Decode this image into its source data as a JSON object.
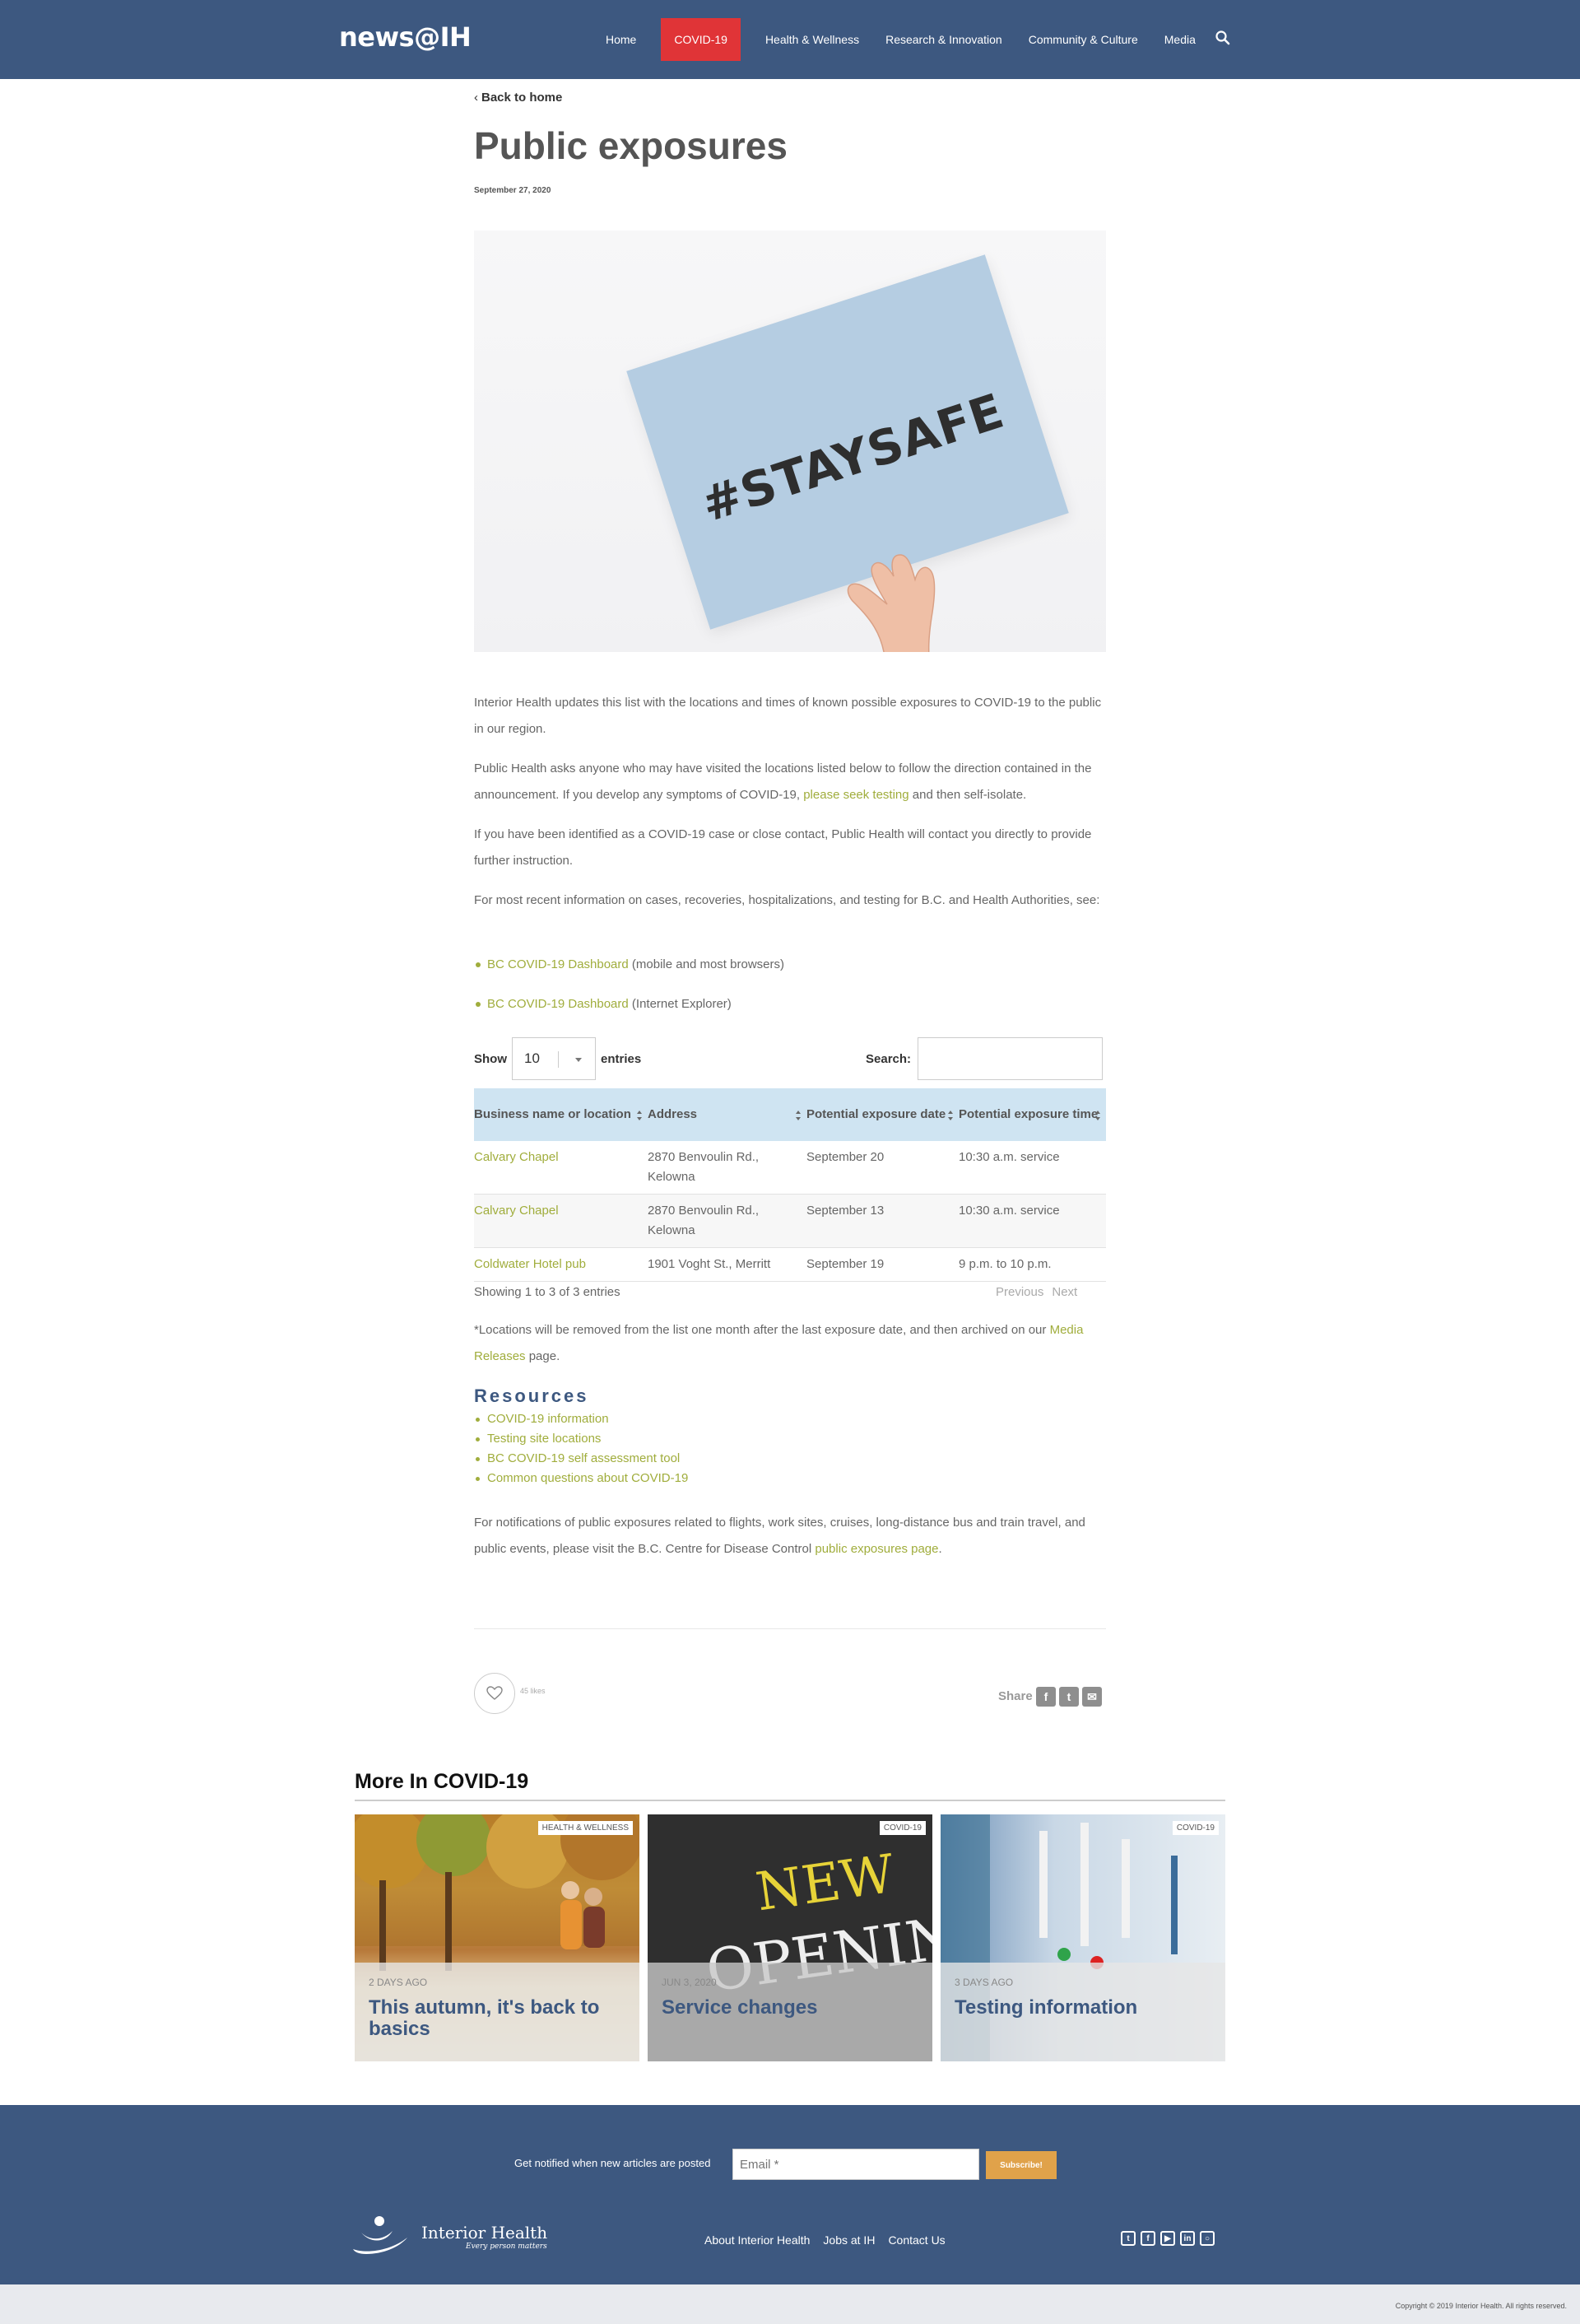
{
  "header": {
    "logo": "news@IH",
    "nav": [
      "Home",
      "COVID-19",
      "Health & Wellness",
      "Research & Innovation",
      "Community & Culture",
      "Media"
    ],
    "active_nav": "COVID-19"
  },
  "article": {
    "back_label": "Back to home",
    "title": "Public exposures",
    "date": "September 27, 2020",
    "hero_text": "#STAYSAFE",
    "p1": "Interior Health updates this list with the locations and times of known possible exposures to COVID-19 to the public in our region.",
    "p2_before": "Public Health asks anyone who may have visited the locations listed below to follow the direction contained in the announcement. If you develop any symptoms of COVID-19, ",
    "p2_link": "please seek testing",
    "p2_after": " and then self-isolate.",
    "p3": "If you have been identified as a COVID-19 case or close contact, Public Health will contact you directly to provide further instruction.",
    "p4": "For most recent information on cases, recoveries, hospitalizations, and testing for B.C. and Health Authorities, see:",
    "dashboard_links": [
      {
        "link": "BC COVID-19 Dashboard",
        "note": " (mobile and most browsers)"
      },
      {
        "link": "BC COVID-19 Dashboard",
        "note": " (Internet Explorer)"
      }
    ]
  },
  "table": {
    "show_label": "Show",
    "entries_value": "10",
    "entries_label": "entries",
    "search_label": "Search:",
    "headers": [
      "Business name or location",
      "Address",
      "Potential exposure date",
      "Potential exposure time"
    ],
    "rows": [
      [
        "Calvary Chapel",
        "2870 Benvoulin Rd., Kelowna",
        "September 20",
        "10:30 a.m. service"
      ],
      [
        "Calvary Chapel",
        "2870 Benvoulin Rd., Kelowna",
        "September 13",
        "10:30 a.m. service"
      ],
      [
        "Coldwater Hotel pub",
        "1901 Voght St., Merritt",
        "September 19",
        "9 p.m. to 10 p.m."
      ]
    ],
    "info": "Showing 1 to 3 of 3 entries",
    "previous": "Previous",
    "next": "Next"
  },
  "after_table": {
    "note_before": "*Locations will be removed from the list one month after the last exposure date, and then archived on our ",
    "note_link": "Media Releases",
    "note_after": " page.",
    "resources_heading": "Resources",
    "resources": [
      "COVID-19 information",
      "Testing site locations",
      "BC COVID-19 self assessment tool",
      "Common questions about COVID-19"
    ],
    "final_before": "For notifications of public exposures related to flights, work sites, cruises, long-distance bus and train travel, and public events, please visit the B.C. Centre for Disease Control ",
    "final_link": "public exposures page",
    "final_after": "."
  },
  "engage": {
    "likes": "45 likes",
    "share_label": "Share"
  },
  "more": {
    "heading": "More In COVID-19",
    "cards": [
      {
        "tag": "HEALTH & WELLNESS",
        "when": "2 DAYS AGO",
        "title": "This autumn, it's back to basics"
      },
      {
        "tag": "COVID-19",
        "when": "JUN 3, 2020",
        "title": "Service changes",
        "image_text_1": "NEW",
        "image_text_2": "OPENING"
      },
      {
        "tag": "COVID-19",
        "when": "3 DAYS AGO",
        "title": "Testing information"
      }
    ]
  },
  "footer": {
    "notify": "Get notified when new articles are posted",
    "email_placeholder": "Email *",
    "subscribe": "Subscribe!",
    "brand": "Interior Health",
    "tagline": "Every person matters",
    "links": [
      "About Interior Health",
      "Jobs at IH",
      "Contact Us"
    ],
    "social": [
      "twitter-icon",
      "facebook-icon",
      "youtube-icon",
      "linkedin-icon",
      "instagram-icon"
    ],
    "copyright": "Copyright © 2019 Interior Health. All rights reserved."
  },
  "colors": {
    "brand": "#3d5880",
    "active": "#e03437",
    "link": "#a0ad3c",
    "table_header": "#cfe4f2",
    "subscribe": "#e0a24a"
  }
}
